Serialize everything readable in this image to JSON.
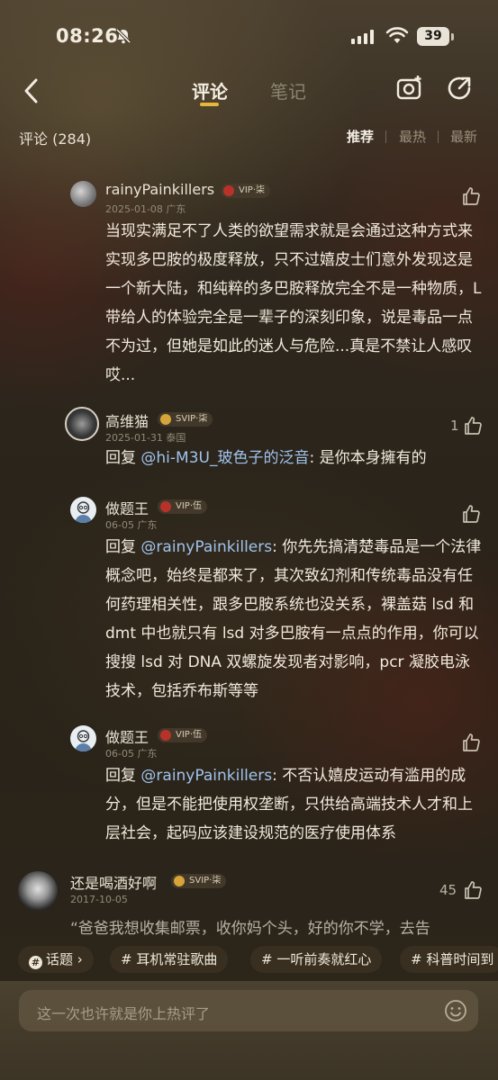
{
  "status_bar": {
    "time": "08:26",
    "battery": "39"
  },
  "nav": {
    "tab_comments": "评论",
    "tab_notes": "笔记"
  },
  "comments_header": {
    "count_label": "评论 (284)",
    "sort_options": [
      "推荐",
      "最热",
      "最新"
    ]
  },
  "comments": [
    {
      "user": "rainyPainkillers",
      "badge": "VIP·柒",
      "meta": "2025-01-08 广东",
      "text": "当现实满足不了人类的欲望需求就是会通过这种方式来实现多巴胺的极度释放，只不过嬉皮士们意外发现这是一个新大陆，和纯粹的多巴胺释放完全不是一种物质，L 带给人的体验完全是一辈子的深刻印象，说是毒品一点不为过，但她是如此的迷人与危险...真是不禁让人感叹哎..."
    },
    {
      "user": "高维猫",
      "badge": "SVIP·柒",
      "meta": "2025-01-31 泰国",
      "reply_prefix": "回复 ",
      "mention": "@hi-M3U_玻色子的泛音",
      "text": ": 是你本身擁有的",
      "likes": "1"
    },
    {
      "user": "做题王",
      "badge": "VIP·伍",
      "meta": "06-05 广东",
      "reply_prefix": "回复 ",
      "mention": "@rainyPainkillers",
      "text": ": 你先先搞清楚毒品是一个法律概念吧，始终是都来了，其次致幻剂和传统毒品没有任何药理相关性，跟多巴胺系统也没关系，裸盖菇 lsd 和 dmt 中也就只有 lsd 对多巴胺有一点点的作用，你可以搜搜 lsd 对 DNA 双螺旋发现者对影响，pcr 凝胶电泳技术，包括乔布斯等等"
    },
    {
      "user": "做题王",
      "badge": "VIP·伍",
      "meta": "06-05 广东",
      "reply_prefix": "回复 ",
      "mention": "@rainyPainkillers",
      "text": ": 不否认嬉皮运动有滥用的成分，但是不能把使用权垄断，只供给高端技术人才和上层社会，起码应该建设规范的医疗使用体系"
    },
    {
      "user": "还是喝酒好啊",
      "badge": "SVIP·柒",
      "meta": "2017-10-05",
      "text": "“爸爸我想收集邮票，收你妈个头，好的你不学，去告",
      "likes": "45"
    }
  ],
  "topics": [
    "话题",
    "# 耳机常驻歌曲",
    "# 一听前奏就红心",
    "# 科普时间到"
  ],
  "input": {
    "placeholder": "这一次也许就是你上热评了"
  },
  "colors": {
    "accent": "#e7b53a",
    "mention": "#9fc3ec",
    "vip_red": "#b8322a",
    "svip_gold": "#d7a43a"
  }
}
